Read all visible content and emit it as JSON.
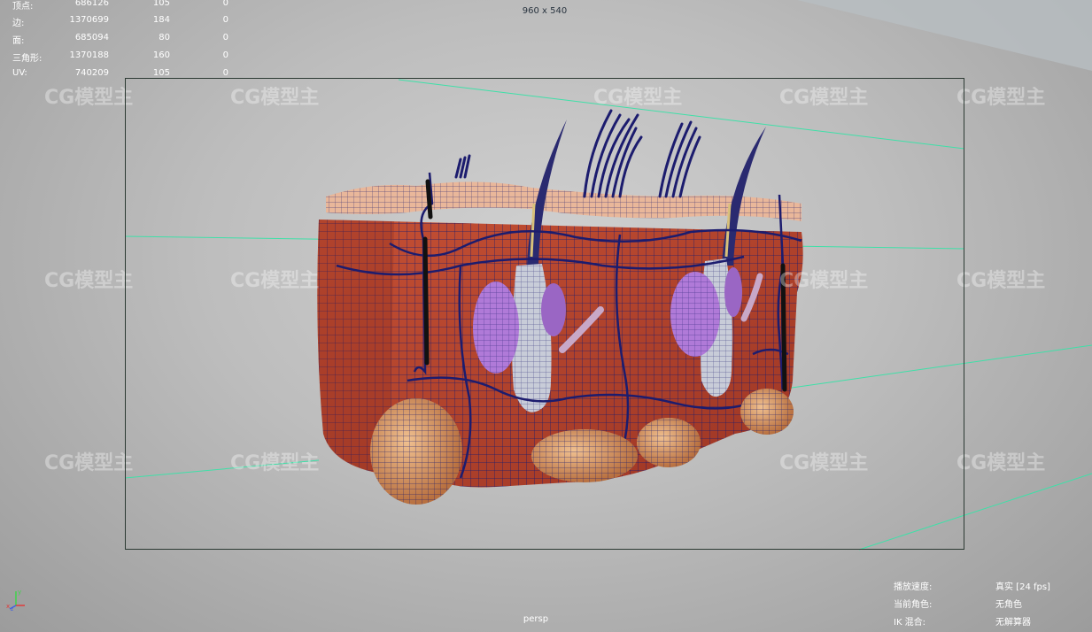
{
  "viewport": {
    "resolution": "960 x 540",
    "camera": "persp"
  },
  "stats": [
    {
      "label": "顶点:",
      "v1": "686126",
      "v2": "105",
      "v3": "0"
    },
    {
      "label": "边:",
      "v1": "1370699",
      "v2": "184",
      "v3": "0"
    },
    {
      "label": "面:",
      "v1": "685094",
      "v2": "80",
      "v3": "0"
    },
    {
      "label": "三角形:",
      "v1": "1370188",
      "v2": "160",
      "v3": "0"
    },
    {
      "label": "UV:",
      "v1": "740209",
      "v2": "105",
      "v3": "0"
    }
  ],
  "playback": {
    "speed_label": "播放速度:",
    "speed_value": "真实 [24 fps]",
    "character_label": "当前角色:",
    "character_value": "无角色",
    "ik_label": "IK 混合:",
    "ik_value": "无解算器"
  },
  "watermark": "CG模型主",
  "colors": {
    "tissue": "#b8452e",
    "epidermis": "#e9b79a",
    "wire": "#1c1c6e",
    "gland": "#b07ad8",
    "follicle": "#c8ccd8",
    "fat": "#d89a6a",
    "grid_line": "#3fe0a8"
  },
  "axis_icon": "xyz-axis-icon"
}
